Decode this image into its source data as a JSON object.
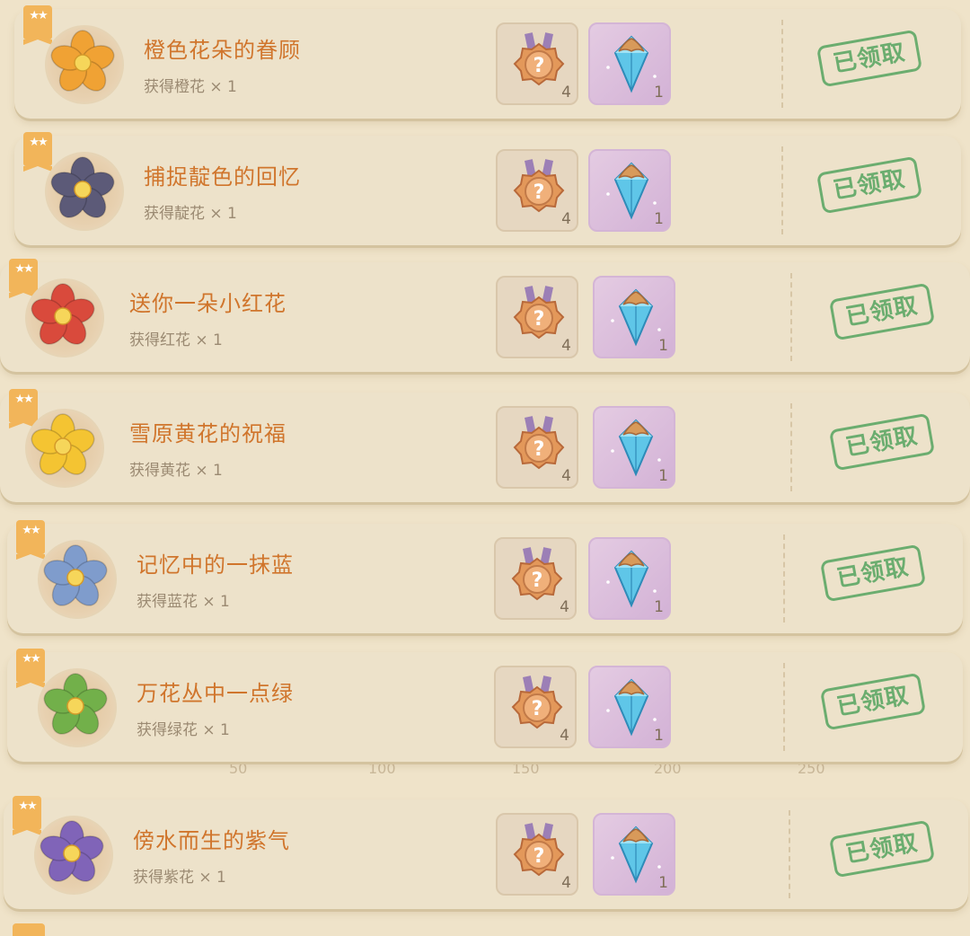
{
  "colors": {
    "title": "#d0752c",
    "stamp": "#5ea866",
    "star_tag": "#f2b55a"
  },
  "achievements": [
    {
      "title": "橙色花朵的眷顾",
      "subtitle": "获得橙花 × 1",
      "flower_icon": "orange-flower-icon",
      "flower_color": "#f0a234",
      "reward_medal_count": "4",
      "reward_gem_count": "1",
      "status": "已领取"
    },
    {
      "title": "捕捉靛色的回忆",
      "subtitle": "获得靛花 × 1",
      "flower_icon": "indigo-flower-icon",
      "flower_color": "#5c5a78",
      "reward_medal_count": "4",
      "reward_gem_count": "1",
      "status": "已领取"
    },
    {
      "title": "送你一朵小红花",
      "subtitle": "获得红花 × 1",
      "flower_icon": "red-flower-icon",
      "flower_color": "#d94a3c",
      "reward_medal_count": "4",
      "reward_gem_count": "1",
      "status": "已领取"
    },
    {
      "title": "雪原黄花的祝福",
      "subtitle": "获得黄花 × 1",
      "flower_icon": "yellow-flower-icon",
      "flower_color": "#f4c432",
      "reward_medal_count": "4",
      "reward_gem_count": "1",
      "status": "已领取"
    },
    {
      "title": "记忆中的一抹蓝",
      "subtitle": "获得蓝花 × 1",
      "flower_icon": "blue-flower-icon",
      "flower_color": "#7f9ccc",
      "reward_medal_count": "4",
      "reward_gem_count": "1",
      "status": "已领取"
    },
    {
      "title": "万花丛中一点绿",
      "subtitle": "获得绿花 × 1",
      "flower_icon": "green-flower-icon",
      "flower_color": "#72b04a",
      "reward_medal_count": "4",
      "reward_gem_count": "1",
      "status": "已领取"
    },
    {
      "title": "傍水而生的紫气",
      "subtitle": "获得紫花 × 1",
      "flower_icon": "purple-flower-icon",
      "flower_color": "#8064b8",
      "reward_medal_count": "4",
      "reward_gem_count": "1",
      "status": "已领取"
    }
  ],
  "background_ticks": [
    "50",
    "100",
    "150",
    "200",
    "250"
  ]
}
